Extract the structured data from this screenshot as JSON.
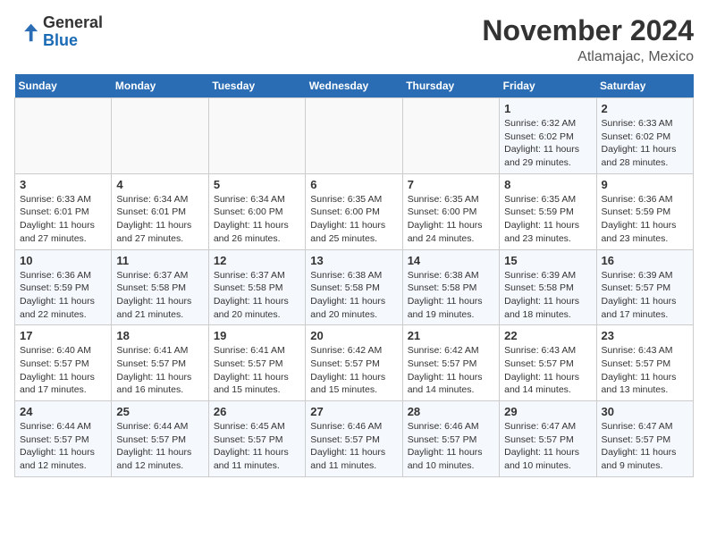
{
  "header": {
    "logo_general": "General",
    "logo_blue": "Blue",
    "month_title": "November 2024",
    "location": "Atlamajac, Mexico"
  },
  "weekdays": [
    "Sunday",
    "Monday",
    "Tuesday",
    "Wednesday",
    "Thursday",
    "Friday",
    "Saturday"
  ],
  "weeks": [
    [
      {
        "day": "",
        "info": ""
      },
      {
        "day": "",
        "info": ""
      },
      {
        "day": "",
        "info": ""
      },
      {
        "day": "",
        "info": ""
      },
      {
        "day": "",
        "info": ""
      },
      {
        "day": "1",
        "info": "Sunrise: 6:32 AM\nSunset: 6:02 PM\nDaylight: 11 hours and 29 minutes."
      },
      {
        "day": "2",
        "info": "Sunrise: 6:33 AM\nSunset: 6:02 PM\nDaylight: 11 hours and 28 minutes."
      }
    ],
    [
      {
        "day": "3",
        "info": "Sunrise: 6:33 AM\nSunset: 6:01 PM\nDaylight: 11 hours and 27 minutes."
      },
      {
        "day": "4",
        "info": "Sunrise: 6:34 AM\nSunset: 6:01 PM\nDaylight: 11 hours and 27 minutes."
      },
      {
        "day": "5",
        "info": "Sunrise: 6:34 AM\nSunset: 6:00 PM\nDaylight: 11 hours and 26 minutes."
      },
      {
        "day": "6",
        "info": "Sunrise: 6:35 AM\nSunset: 6:00 PM\nDaylight: 11 hours and 25 minutes."
      },
      {
        "day": "7",
        "info": "Sunrise: 6:35 AM\nSunset: 6:00 PM\nDaylight: 11 hours and 24 minutes."
      },
      {
        "day": "8",
        "info": "Sunrise: 6:35 AM\nSunset: 5:59 PM\nDaylight: 11 hours and 23 minutes."
      },
      {
        "day": "9",
        "info": "Sunrise: 6:36 AM\nSunset: 5:59 PM\nDaylight: 11 hours and 23 minutes."
      }
    ],
    [
      {
        "day": "10",
        "info": "Sunrise: 6:36 AM\nSunset: 5:59 PM\nDaylight: 11 hours and 22 minutes."
      },
      {
        "day": "11",
        "info": "Sunrise: 6:37 AM\nSunset: 5:58 PM\nDaylight: 11 hours and 21 minutes."
      },
      {
        "day": "12",
        "info": "Sunrise: 6:37 AM\nSunset: 5:58 PM\nDaylight: 11 hours and 20 minutes."
      },
      {
        "day": "13",
        "info": "Sunrise: 6:38 AM\nSunset: 5:58 PM\nDaylight: 11 hours and 20 minutes."
      },
      {
        "day": "14",
        "info": "Sunrise: 6:38 AM\nSunset: 5:58 PM\nDaylight: 11 hours and 19 minutes."
      },
      {
        "day": "15",
        "info": "Sunrise: 6:39 AM\nSunset: 5:58 PM\nDaylight: 11 hours and 18 minutes."
      },
      {
        "day": "16",
        "info": "Sunrise: 6:39 AM\nSunset: 5:57 PM\nDaylight: 11 hours and 17 minutes."
      }
    ],
    [
      {
        "day": "17",
        "info": "Sunrise: 6:40 AM\nSunset: 5:57 PM\nDaylight: 11 hours and 17 minutes."
      },
      {
        "day": "18",
        "info": "Sunrise: 6:41 AM\nSunset: 5:57 PM\nDaylight: 11 hours and 16 minutes."
      },
      {
        "day": "19",
        "info": "Sunrise: 6:41 AM\nSunset: 5:57 PM\nDaylight: 11 hours and 15 minutes."
      },
      {
        "day": "20",
        "info": "Sunrise: 6:42 AM\nSunset: 5:57 PM\nDaylight: 11 hours and 15 minutes."
      },
      {
        "day": "21",
        "info": "Sunrise: 6:42 AM\nSunset: 5:57 PM\nDaylight: 11 hours and 14 minutes."
      },
      {
        "day": "22",
        "info": "Sunrise: 6:43 AM\nSunset: 5:57 PM\nDaylight: 11 hours and 14 minutes."
      },
      {
        "day": "23",
        "info": "Sunrise: 6:43 AM\nSunset: 5:57 PM\nDaylight: 11 hours and 13 minutes."
      }
    ],
    [
      {
        "day": "24",
        "info": "Sunrise: 6:44 AM\nSunset: 5:57 PM\nDaylight: 11 hours and 12 minutes."
      },
      {
        "day": "25",
        "info": "Sunrise: 6:44 AM\nSunset: 5:57 PM\nDaylight: 11 hours and 12 minutes."
      },
      {
        "day": "26",
        "info": "Sunrise: 6:45 AM\nSunset: 5:57 PM\nDaylight: 11 hours and 11 minutes."
      },
      {
        "day": "27",
        "info": "Sunrise: 6:46 AM\nSunset: 5:57 PM\nDaylight: 11 hours and 11 minutes."
      },
      {
        "day": "28",
        "info": "Sunrise: 6:46 AM\nSunset: 5:57 PM\nDaylight: 11 hours and 10 minutes."
      },
      {
        "day": "29",
        "info": "Sunrise: 6:47 AM\nSunset: 5:57 PM\nDaylight: 11 hours and 10 minutes."
      },
      {
        "day": "30",
        "info": "Sunrise: 6:47 AM\nSunset: 5:57 PM\nDaylight: 11 hours and 9 minutes."
      }
    ]
  ]
}
